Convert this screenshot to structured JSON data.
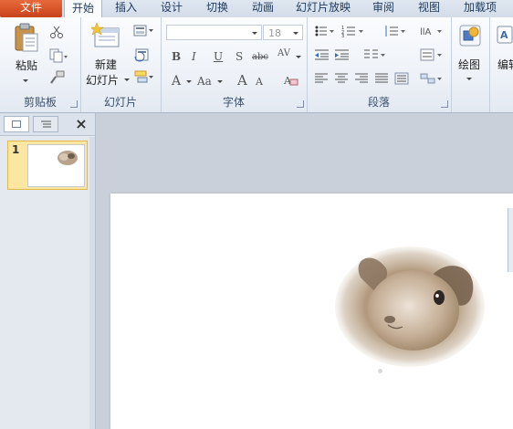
{
  "tabs": [
    {
      "label": "文件",
      "active": false,
      "file": true
    },
    {
      "label": "开始",
      "active": true
    },
    {
      "label": "插入"
    },
    {
      "label": "设计"
    },
    {
      "label": "切换"
    },
    {
      "label": "动画"
    },
    {
      "label": "幻灯片放映"
    },
    {
      "label": "审阅"
    },
    {
      "label": "视图"
    },
    {
      "label": "加载项"
    }
  ],
  "ribbon": {
    "clipboard": {
      "paste_label": "粘贴",
      "group_label": "剪贴板"
    },
    "slides": {
      "new_slide_label_1": "新建",
      "new_slide_label_2": "幻灯片",
      "group_label": "幻灯片"
    },
    "font": {
      "font_name": "",
      "font_size": "18",
      "group_label": "字体"
    },
    "paragraph": {
      "group_label": "段落"
    },
    "drawing": {
      "draw_label": "绘图"
    },
    "editing": {
      "edit_label": "编辑"
    }
  },
  "left_panel": {
    "slide_number": "1"
  },
  "colors": {
    "file_tab": "#d65428",
    "selection": "#fbe7a2",
    "ribbon": "#eef2f8"
  }
}
